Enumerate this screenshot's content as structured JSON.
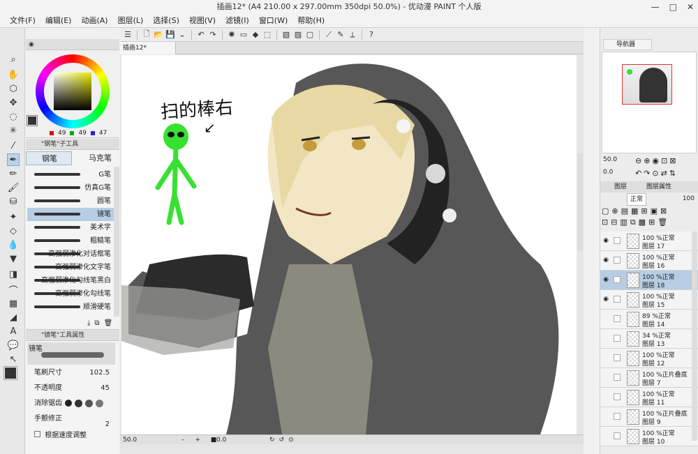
{
  "window": {
    "title": "插画12* (A4 210.00 x 297.00mm 350dpi 50.0%) - 优动漫 PAINT 个人版",
    "controls": [
      "—",
      "□",
      "✕"
    ]
  },
  "menu": [
    "文件(F)",
    "编辑(E)",
    "动画(A)",
    "图层(L)",
    "选择(S)",
    "视图(V)",
    "滤镜(I)",
    "窗口(W)",
    "帮助(H)"
  ],
  "color": {
    "r": "49",
    "g": "49",
    "b": "47",
    "main_color": "#333333",
    "accent": "#5b8fc7"
  },
  "subtool": {
    "header": "\"钢笔\"子工具",
    "tabs": [
      "钢笔",
      "马克笔"
    ],
    "brushes": [
      "G笔",
      "仿真G笔",
      "圆笔",
      "镜笔",
      "美术字",
      "粗糙笔",
      "高强弱渗化对话框笔",
      "高强弱渗化文字笔",
      "高强弱渗化勾线笔黑白",
      "高强弱渗化勾线笔",
      "顺滑硬笔"
    ],
    "selected": 3
  },
  "toolprops": {
    "header": "\"镜笔\"工具属性",
    "brush_name": "镜笔",
    "size_label": "笔刷尺寸",
    "size_value": "102.5",
    "opacity_label": "不透明度",
    "opacity_value": "45",
    "antialias_label": "消除锯齿",
    "stabilizer_label": "手颤修正",
    "stabilizer_value": "2",
    "speed_label": "根据速度调整"
  },
  "canvas": {
    "tab": "插画12*",
    "annotation": "扫的棒右",
    "arrow": "↙",
    "zoom": "50.0",
    "angle": "0.0"
  },
  "navigator": {
    "header": "导航器",
    "zoom": "50.0",
    "angle": "0.0"
  },
  "layers": {
    "tabs": [
      "图层",
      "图层属性"
    ],
    "blend_mode": "正常",
    "opacity": "100",
    "items": [
      {
        "mode": "100 %正常",
        "name": "图层 17",
        "visible": true,
        "selected": false
      },
      {
        "mode": "100 %正常",
        "name": "图层 16",
        "visible": true,
        "selected": false
      },
      {
        "mode": "100 %正常",
        "name": "图层 18",
        "visible": true,
        "selected": true
      },
      {
        "mode": "100 %正常",
        "name": "图层 15",
        "visible": true,
        "selected": false
      },
      {
        "mode": "89 %正常",
        "name": "图层 14",
        "visible": false,
        "selected": false
      },
      {
        "mode": "34 %正常",
        "name": "图层 13",
        "visible": false,
        "selected": false
      },
      {
        "mode": "100 %正常",
        "name": "图层 12",
        "visible": false,
        "selected": false
      },
      {
        "mode": "100 %正片叠底",
        "name": "图层 7",
        "visible": false,
        "selected": false
      },
      {
        "mode": "100 %正常",
        "name": "图层 11",
        "visible": false,
        "selected": false
      },
      {
        "mode": "100 %正片叠底",
        "name": "图层 9",
        "visible": false,
        "selected": false
      },
      {
        "mode": "100 %正常",
        "name": "图层 10",
        "visible": false,
        "selected": false
      }
    ]
  }
}
